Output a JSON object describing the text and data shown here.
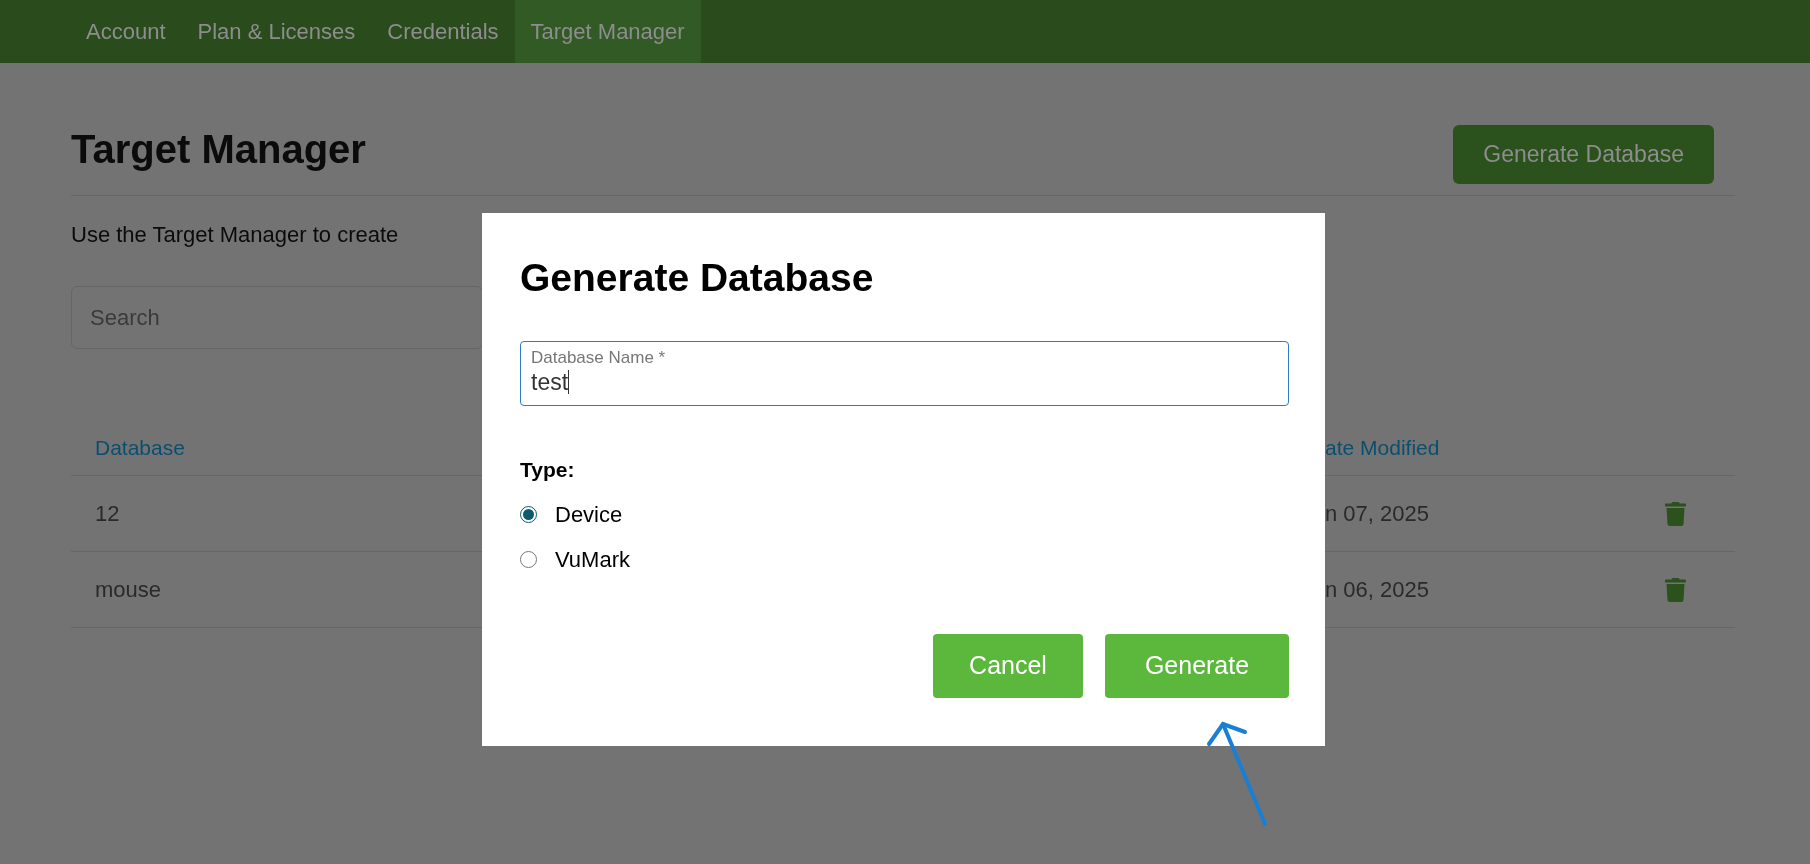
{
  "nav": {
    "tabs": [
      {
        "label": "Account",
        "selected": false
      },
      {
        "label": "Plan & Licenses",
        "selected": false
      },
      {
        "label": "Credentials",
        "selected": false
      },
      {
        "label": "Target Manager",
        "selected": true
      }
    ]
  },
  "page": {
    "title": "Target Manager",
    "action_button": "Generate Database",
    "description": "Use the Target Manager to create",
    "search": {
      "placeholder": "Search"
    },
    "table": {
      "columns": [
        "Database",
        "ate Modified"
      ],
      "rows": [
        {
          "database": "12",
          "date_modified": "n 07, 2025"
        },
        {
          "database": "mouse",
          "date_modified": "n 06, 2025"
        }
      ]
    }
  },
  "dialog": {
    "title": "Generate Database",
    "name_field": {
      "label": "Database Name *",
      "value": "test"
    },
    "type_label": "Type:",
    "options": [
      {
        "label": "Device",
        "selected": true
      },
      {
        "label": "VuMark",
        "selected": false
      }
    ],
    "buttons": [
      "Cancel",
      "Generate"
    ]
  }
}
